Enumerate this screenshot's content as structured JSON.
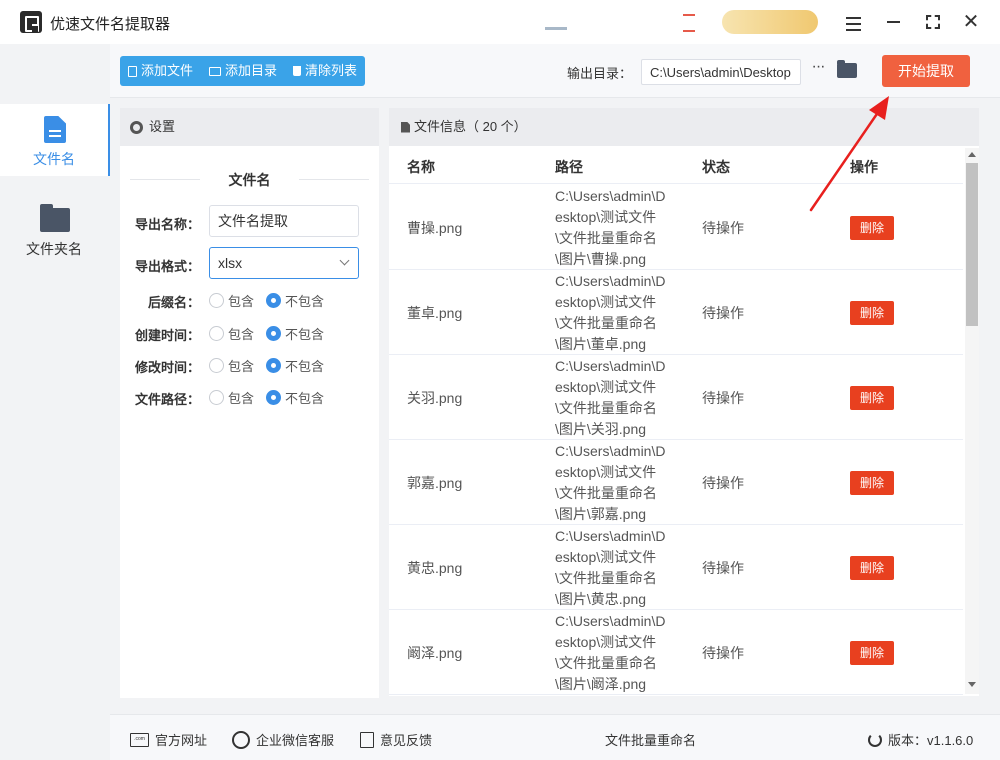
{
  "titlebar": {
    "title": "优速文件名提取器"
  },
  "nav": {
    "items": [
      {
        "label": "文件名",
        "icon": "file-icon",
        "active": true
      },
      {
        "label": "文件夹名",
        "icon": "folder-icon",
        "active": false
      }
    ]
  },
  "toolbar": {
    "add_file": "添加文件",
    "add_dir": "添加目录",
    "clear_list": "清除列表",
    "output_label": "输出目录：",
    "output_value": "C:\\Users\\admin\\Desktop",
    "more": "···",
    "start": "开始提取"
  },
  "settings": {
    "header": "设置",
    "section_title": "文件名",
    "export_name_label": "导出名称：",
    "export_name_value": "文件名提取",
    "export_format_label": "导出格式：",
    "export_format_value": "xlsx",
    "options": [
      {
        "label": "后缀名：",
        "include": "包含",
        "exclude": "不包含",
        "selected": "exclude"
      },
      {
        "label": "创建时间：",
        "include": "包含",
        "exclude": "不包含",
        "selected": "exclude"
      },
      {
        "label": "修改时间：",
        "include": "包含",
        "exclude": "不包含",
        "selected": "exclude"
      },
      {
        "label": "文件路径：",
        "include": "包含",
        "exclude": "不包含",
        "selected": "exclude"
      }
    ]
  },
  "files": {
    "header": "文件信息（ 20 个）",
    "columns": [
      "名称",
      "路径",
      "状态",
      "操作"
    ],
    "delete_label": "删除",
    "rows": [
      {
        "name": "曹操.png",
        "path": "C:\\Users\\admin\\Desktop\\测试文件\\文件批量重命名\\图片\\曹操.png",
        "status": "待操作"
      },
      {
        "name": "董卓.png",
        "path": "C:\\Users\\admin\\Desktop\\测试文件\\文件批量重命名\\图片\\董卓.png",
        "status": "待操作"
      },
      {
        "name": "关羽.png",
        "path": "C:\\Users\\admin\\Desktop\\测试文件\\文件批量重命名\\图片\\关羽.png",
        "status": "待操作"
      },
      {
        "name": "郭嘉.png",
        "path": "C:\\Users\\admin\\Desktop\\测试文件\\文件批量重命名\\图片\\郭嘉.png",
        "status": "待操作"
      },
      {
        "name": "黄忠.png",
        "path": "C:\\Users\\admin\\Desktop\\测试文件\\文件批量重命名\\图片\\黄忠.png",
        "status": "待操作"
      },
      {
        "name": "阚泽.png",
        "path": "C:\\Users\\admin\\Desktop\\测试文件\\文件批量重命名\\图片\\阚泽.png",
        "status": "待操作"
      }
    ]
  },
  "bottom": {
    "website": "官方网址",
    "wechat": "企业微信客服",
    "feedback": "意见反馈",
    "center": "文件批量重命名",
    "version": "版本：v1.1.6.0"
  },
  "colors": {
    "accent": "#3a8ee6",
    "toolbar_button": "#3aa3e8",
    "start_button": "#f0613f",
    "delete_button": "#e8401f",
    "annotation_arrow": "#e8201e"
  }
}
